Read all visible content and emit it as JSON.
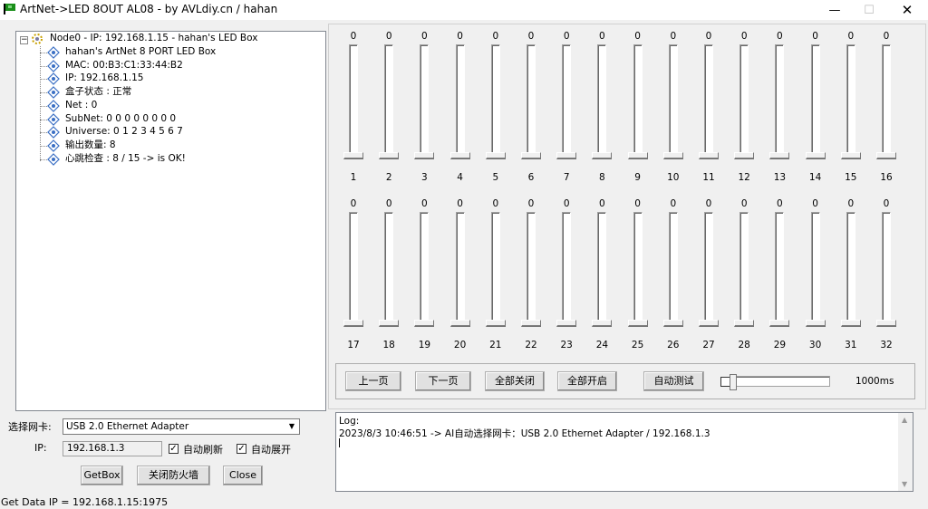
{
  "window": {
    "title": "ArtNet->LED 8OUT AL08 - by AVLdiy.cn / hahan",
    "minimize": "—",
    "maximize": "☐",
    "close": "✕"
  },
  "tree": {
    "root": "Node0 - IP: 192.168.1.15 - hahan's LED Box",
    "expander": "−",
    "children": [
      "hahan's ArtNet 8 PORT LED Box",
      "MAC: 00:B3:C1:33:44:B2",
      "IP: 192.168.1.15",
      "盒子状态 : 正常",
      "Net : 0",
      "SubNet:   0 0 0 0 0 0 0 0",
      "Universe: 0 1 2 3 4 5 6 7",
      "输出数量: 8",
      "心跳检查 : 8 / 15 -> is OK!"
    ]
  },
  "nic": {
    "label": "选择网卡:",
    "value": "USB 2.0 Ethernet Adapter"
  },
  "ip": {
    "label": "IP:",
    "value": "192.168.1.3"
  },
  "options": {
    "auto_refresh": "自动刷新",
    "auto_expand": "自动展开",
    "auto_refresh_checked": true,
    "auto_expand_checked": true,
    "check_mark": "✓"
  },
  "buttons": {
    "getbox": "GetBox",
    "firewall": "关闭防火墙",
    "close": "Close",
    "prev": "上一页",
    "next": "下一页",
    "all_off": "全部关闭",
    "all_on": "全部开启",
    "auto_test": "自动测试"
  },
  "channels_row1": {
    "values": [
      "0",
      "0",
      "0",
      "0",
      "0",
      "0",
      "0",
      "0",
      "0",
      "0",
      "0",
      "0",
      "0",
      "0",
      "0",
      "0"
    ],
    "numbers": [
      "1",
      "2",
      "3",
      "4",
      "5",
      "6",
      "7",
      "8",
      "9",
      "10",
      "11",
      "12",
      "13",
      "14",
      "15",
      "16"
    ]
  },
  "channels_row2": {
    "values": [
      "0",
      "0",
      "0",
      "0",
      "0",
      "0",
      "0",
      "0",
      "0",
      "0",
      "0",
      "0",
      "0",
      "0",
      "0",
      "0"
    ],
    "numbers": [
      "17",
      "18",
      "19",
      "20",
      "21",
      "22",
      "23",
      "24",
      "25",
      "26",
      "27",
      "28",
      "29",
      "30",
      "31",
      "32"
    ]
  },
  "auto_speed": {
    "value": "1000ms",
    "checked": false
  },
  "log": {
    "header": "Log:",
    "lines": [
      "2023/8/3 10:46:51 -> AI自动选择网卡：USB 2.0 Ethernet Adapter / 192.168.1.3"
    ]
  },
  "status": "Get Data IP = 192.168.1.15:1975",
  "colors": {
    "window_bg": "#f0f0f0",
    "panel_bg": "#ffffff",
    "border": "#828790",
    "icon_green": "#1a8f1a",
    "tree_icon": "#3a6fc4"
  }
}
